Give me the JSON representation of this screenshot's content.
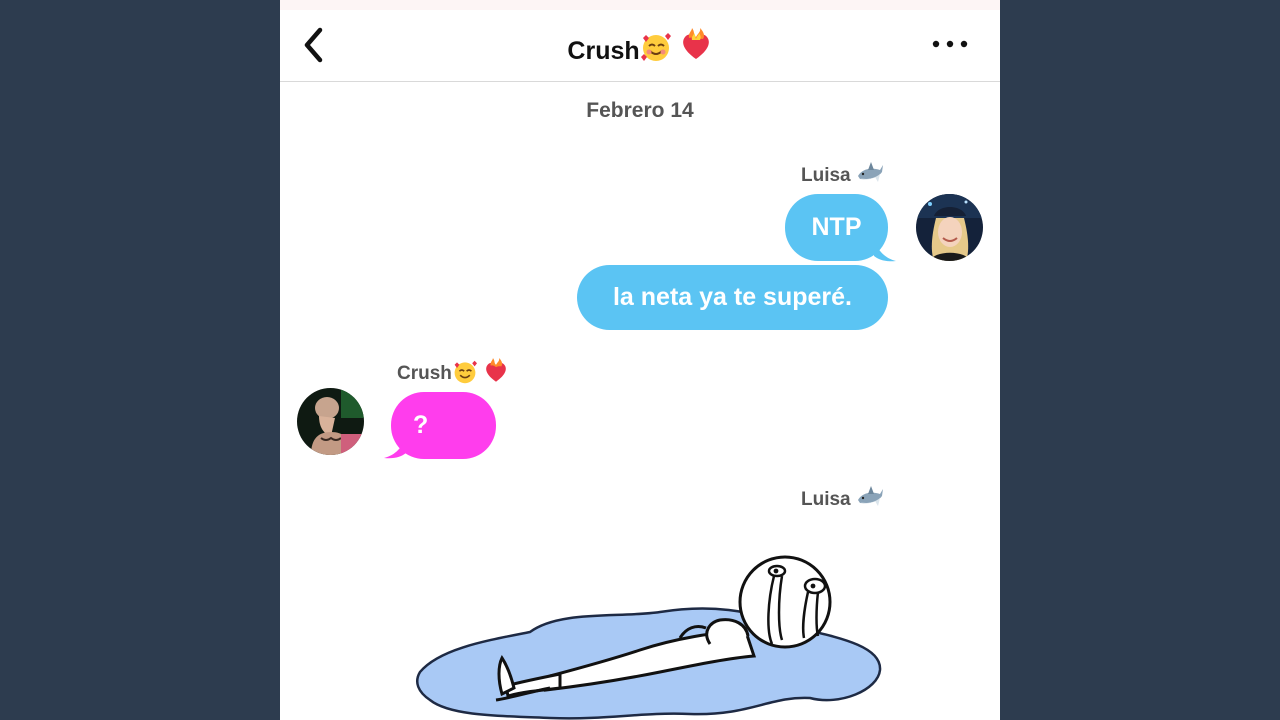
{
  "header": {
    "title": "Crush",
    "title_emojis": [
      "smiling-face-with-hearts",
      "heart-on-fire"
    ],
    "back_icon": "chevron-left-icon",
    "more_icon": "more-dots-icon"
  },
  "conversation": {
    "date": "Febrero 14",
    "groups": [
      {
        "sender": "Luisa",
        "sender_emoji": "shark",
        "direction": "outgoing",
        "messages": [
          "NTP",
          "la neta ya te superé."
        ]
      },
      {
        "sender": "Crush",
        "sender_emojis": [
          "smiling-face-with-hearts",
          "heart-on-fire"
        ],
        "direction": "incoming",
        "messages": [
          "?"
        ]
      },
      {
        "sender": "Luisa",
        "sender_emoji": "shark",
        "direction": "outgoing",
        "attachment": "crying-stick-figure-lying-in-puddle-drawing"
      }
    ]
  },
  "colors": {
    "background": "#2d3c4f",
    "outgoing_bubble": "#5bc4f3",
    "incoming_bubble": "#ff3ded",
    "puddle": "#a9c9f5"
  }
}
